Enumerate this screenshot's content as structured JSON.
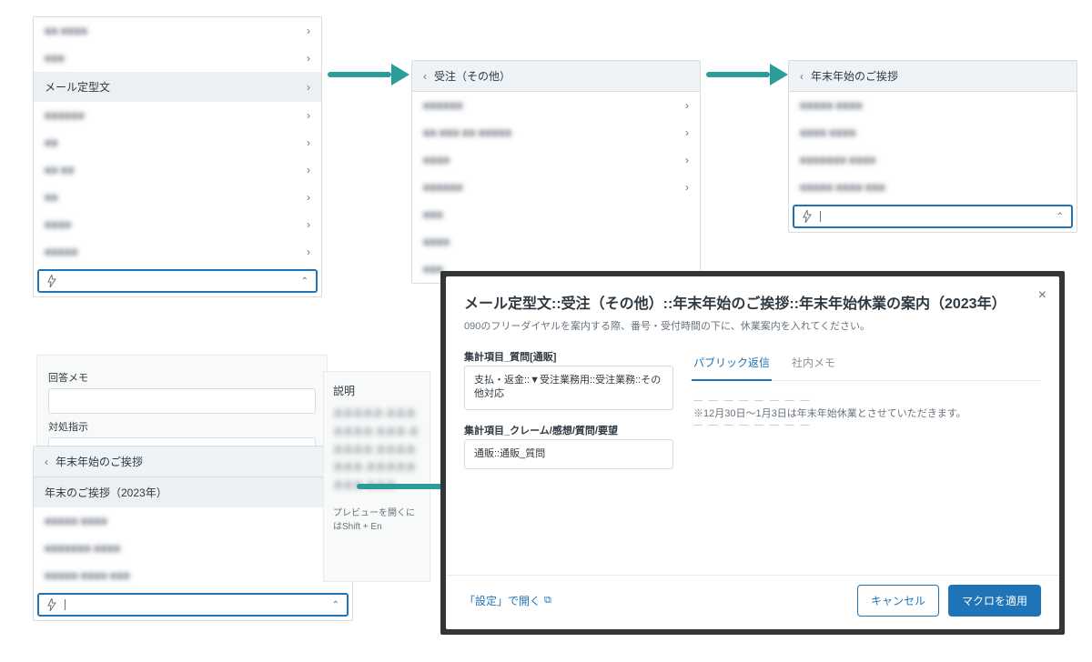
{
  "panel1": {
    "items": [
      {
        "label": "■■ ■■■■",
        "blur": true
      },
      {
        "label": "■■■",
        "blur": true
      },
      {
        "label": "メール定型文",
        "blur": false,
        "highlight": true
      },
      {
        "label": "■■■■■■",
        "blur": true
      },
      {
        "label": "■■",
        "blur": true
      },
      {
        "label": "■■ ■■",
        "blur": true
      },
      {
        "label": "■■",
        "blur": true
      },
      {
        "label": "■■■■",
        "blur": true
      },
      {
        "label": "■■■■■",
        "blur": true
      }
    ]
  },
  "panel2": {
    "header": "受注（その他）",
    "items": [
      {
        "label": "■■■■■■",
        "blur": true
      },
      {
        "label": "■■ ■■■ ■■ ■■■■■",
        "blur": true
      },
      {
        "label": "■■■■",
        "blur": true
      },
      {
        "label": "■■■■■■",
        "blur": true
      },
      {
        "label": "■■■",
        "blur": true,
        "noarrow": true
      },
      {
        "label": "■■■■",
        "blur": true,
        "noarrow": true
      },
      {
        "label": "■■■",
        "blur": true,
        "noarrow": true
      }
    ]
  },
  "panel3": {
    "header": "年末年始のご挨拶",
    "items": [
      {
        "label": "■■■■■ ■■■■",
        "blur": true
      },
      {
        "label": "■■■■ ■■■■",
        "blur": true
      },
      {
        "label": "■■■■■■■ ■■■■",
        "blur": true
      },
      {
        "label": "■■■■■ ■■■■ ■■■",
        "blur": true
      }
    ],
    "search_placeholder": ""
  },
  "sideform": {
    "label_memo": "回答メモ",
    "label_instr": "対処指示"
  },
  "panel4": {
    "header": "年末年始のご挨拶",
    "items": [
      {
        "label": "年末のご挨拶（2023年）",
        "blur": false,
        "eye": true,
        "highlight": true
      },
      {
        "label": "■■■■■ ■■■■",
        "blur": true
      },
      {
        "label": "■■■■■■■ ■■■■",
        "blur": true
      },
      {
        "label": "■■■■■ ■■■■ ■■■",
        "blur": true
      }
    ]
  },
  "desc": {
    "title": "説明",
    "hint": "プレビューを開くにはShift + En"
  },
  "modal": {
    "title": "メール定型文::受注（その他）::年末年始のご挨拶::年末年始休業の案内（2023年）",
    "subtitle": "090のフリーダイヤルを案内する際、番号・受付時間の下に、休業案内を入れてください。",
    "left_group1_label": "集計項目_質問[通販]",
    "left_group1_value": "支払・返金::▼受注業務用::受注業務::その他対応",
    "left_group2_label": "集計項目_クレーム/感想/質問/要望",
    "left_group2_value": "通販::通販_質問",
    "tab_public": "パブリック返信",
    "tab_internal": "社内メモ",
    "reply_body": "※12月30日～1月3日は年末年始休業とさせていただきます。",
    "open_settings": "「設定」で開く",
    "btn_cancel": "キャンセル",
    "btn_apply": "マクロを適用"
  }
}
